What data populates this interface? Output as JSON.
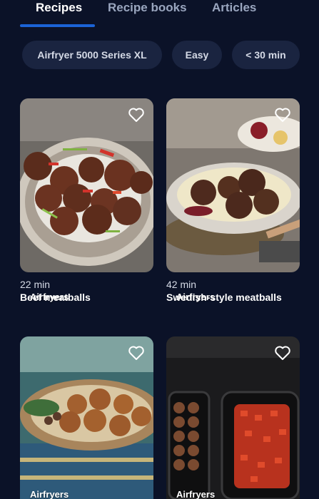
{
  "tabs": [
    {
      "label": "Recipes",
      "active": true
    },
    {
      "label": "Recipe books",
      "active": false
    },
    {
      "label": "Articles",
      "active": false
    }
  ],
  "filters": [
    "Airfryer 5000 Series XL",
    "Easy",
    "< 30 min"
  ],
  "colors": {
    "background": "#0b1228",
    "tab_active_underline": "#1b63d6",
    "chip_background": "#1a2440"
  },
  "recipes": [
    {
      "category": "Airfryers",
      "time": "22 min",
      "title": "Beef meatballs",
      "favorite_icon": "heart-outline-icon"
    },
    {
      "category": "Airfryers",
      "time": "42 min",
      "title": "Swedish-style meatballs",
      "favorite_icon": "heart-outline-icon"
    },
    {
      "category": "Airfryers",
      "time": "",
      "title": "",
      "favorite_icon": "heart-outline-icon"
    },
    {
      "category": "Airfryers",
      "time": "",
      "title": "",
      "favorite_icon": "heart-outline-icon"
    }
  ]
}
